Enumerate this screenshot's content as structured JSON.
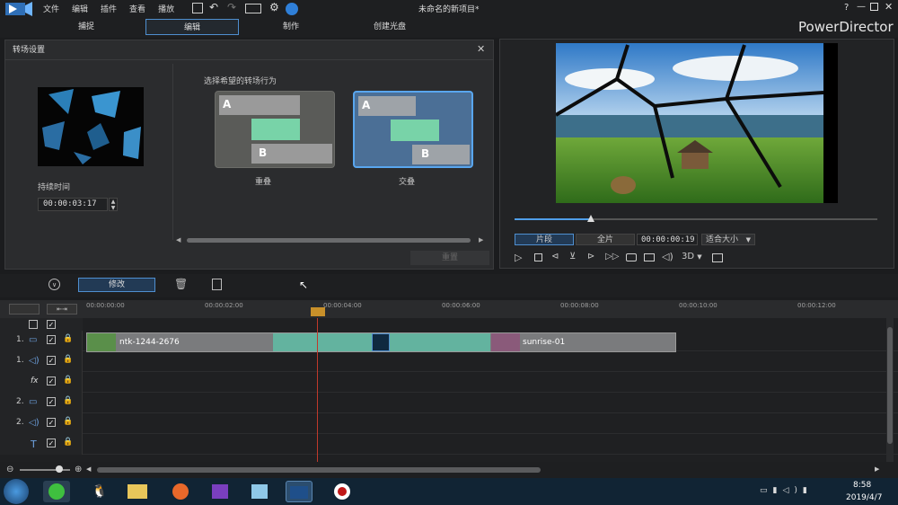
{
  "titlebar": {
    "menu": [
      "文件",
      "编辑",
      "插件",
      "查看",
      "播放"
    ],
    "project_title": "未命名的新项目*",
    "help": "?"
  },
  "modes": [
    "捕捉",
    "编辑",
    "制作",
    "创建光盘"
  ],
  "brand": "PowerDirector",
  "transition_panel": {
    "title": "转场设置",
    "duration_label": "持续时间",
    "duration_value": "00:00:03:17",
    "behavior_prompt": "选择希望的转场行为",
    "option_overlap": "重叠",
    "option_cross": "交叠",
    "apply_button": "重置",
    "clip_a": "A",
    "clip_b": "B"
  },
  "preview": {
    "clip_tab": "片段",
    "movie_tab": "全片",
    "timecode": "00:00:00:19",
    "fit_label": "适合大小",
    "threed_label": "3D",
    "progress": 0.21
  },
  "toolbar": {
    "modify_label": "修改"
  },
  "timeline": {
    "ticks": [
      "00:00:00:00",
      "00:00:02:00",
      "00:00:04:00",
      "00:00:06:00",
      "00:00:08:00",
      "00:00:10:00",
      "00:00:12:00"
    ],
    "tracks": [
      {
        "label": "1.",
        "icon": "video"
      },
      {
        "label": "1.",
        "icon": "audio"
      },
      {
        "label": "fx",
        "icon": "fx"
      },
      {
        "label": "2.",
        "icon": "video"
      },
      {
        "label": "2.",
        "icon": "audio"
      },
      {
        "label": "T",
        "icon": "text"
      }
    ],
    "clip1_name": "ntk-1244-2676",
    "clip2_name": "sunrise-01"
  },
  "taskbar": {
    "time": "8:58",
    "date": "2019/4/7"
  },
  "colors": {
    "accent": "#4f8fd0",
    "clip_green": "#63b39f",
    "transition_green": "#6fcf9f",
    "playhead": "#c0392b"
  }
}
